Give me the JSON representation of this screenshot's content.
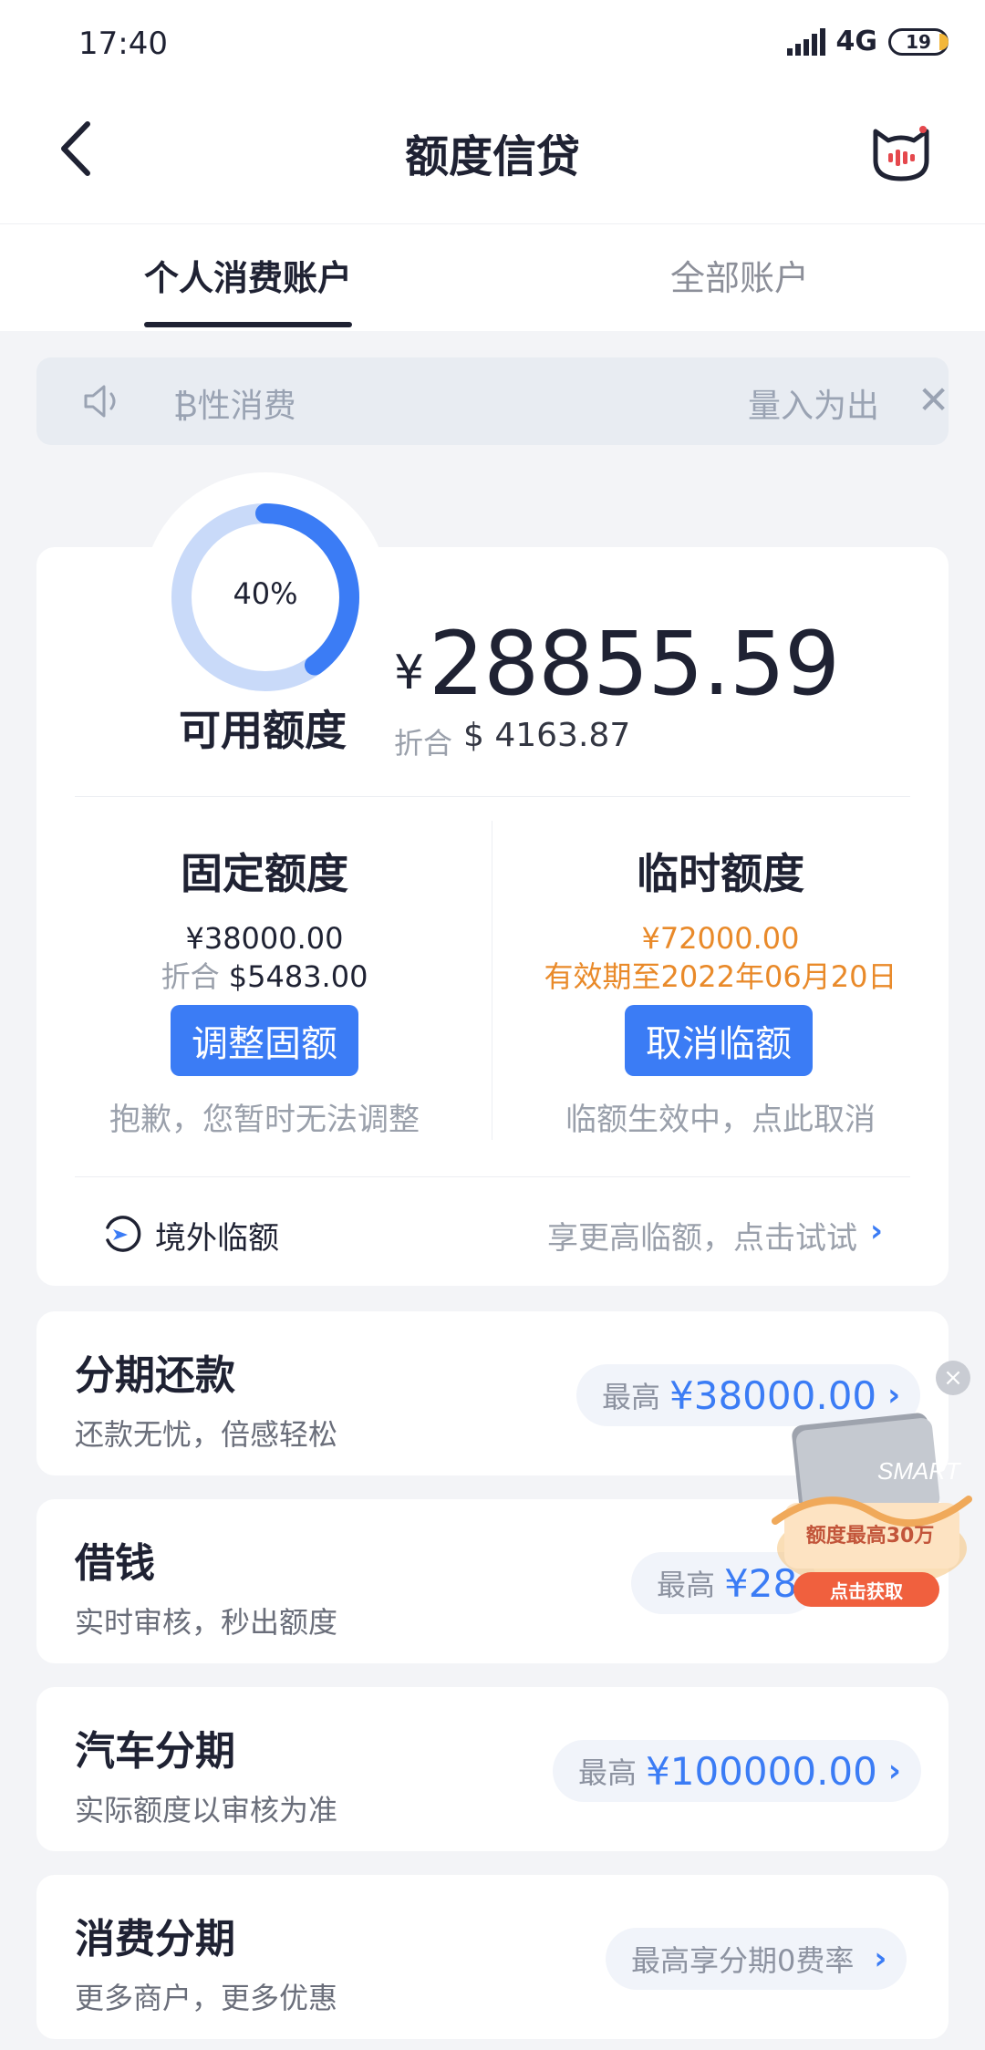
{
  "status_bar": {
    "time": "17:40",
    "network": "4G",
    "battery": "19"
  },
  "header": {
    "title": "额度信贷"
  },
  "tabs": [
    {
      "label": "个人消费账户",
      "active": true
    },
    {
      "label": "全部账户",
      "active": false
    }
  ],
  "notice": {
    "text": "理性消费",
    "text_visible": "₿性消费",
    "right_text": "量入为出"
  },
  "credit": {
    "percent_label": "40%",
    "percent_value": 0.4,
    "available_label": "可用额度",
    "currency_symbol": "¥",
    "available_amount": "28855.59",
    "converted_label": "折合",
    "converted_amount": "$ 4163.87"
  },
  "fixed": {
    "title": "固定额度",
    "amount": "¥38000.00",
    "converted_label": "折合",
    "converted_amount": "$5483.00",
    "button": "调整固额",
    "note": "抱歉，您暂时无法调整"
  },
  "temporary": {
    "title": "临时额度",
    "amount": "¥72000.00",
    "validity": "有效期至2022年06月20日",
    "button": "取消临额",
    "note": "临额生效中，点此取消"
  },
  "overseas": {
    "label": "境外临额",
    "action": "享更高临额，点击试试",
    "chevron": "›"
  },
  "products": [
    {
      "title": "分期还款",
      "desc": "还款无忧，倍感轻松",
      "prefix": "最高",
      "amount": "¥38000.00",
      "chevron": "›"
    },
    {
      "title": "借钱",
      "desc": "实时审核，秒出额度",
      "prefix": "最高",
      "amount": "¥28",
      "chevron": "›"
    },
    {
      "title": "汽车分期",
      "desc": "实际额度以审核为准",
      "prefix": "最高",
      "amount": "¥100000.00",
      "chevron": "›"
    },
    {
      "title": "消费分期",
      "desc": "更多商户，更多优惠",
      "prefix": "最高享分期0费率",
      "amount": "",
      "chevron": "›"
    }
  ],
  "ad": {
    "headline": "额度最高30万",
    "cta": "点击获取",
    "close": "×",
    "card_text": "SMART"
  },
  "colors": {
    "accent": "#3b7cf5",
    "orange": "#e98a2a",
    "donut_track": "#c9daf9"
  }
}
